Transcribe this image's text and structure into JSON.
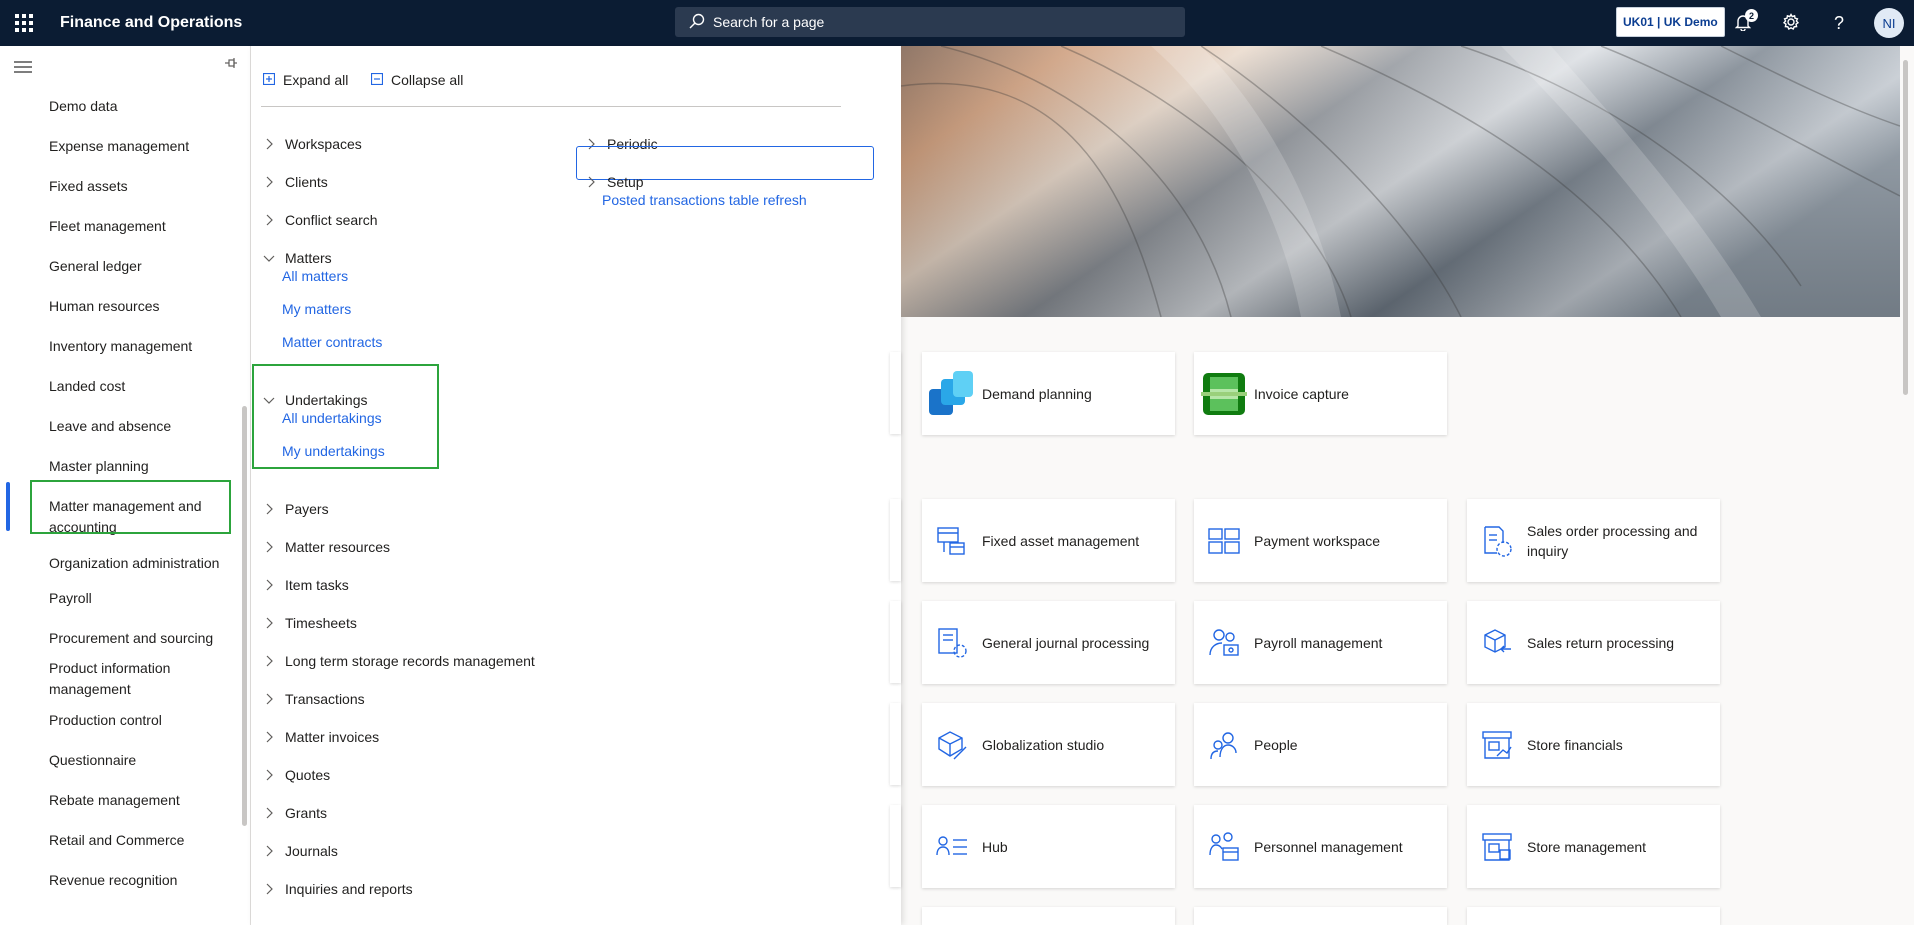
{
  "header": {
    "app_title": "Finance and Operations",
    "search_placeholder": "Search for a page",
    "company": "UK01 | UK Demo",
    "notification_count": "2",
    "help_label": "?",
    "avatar_initials": "NI"
  },
  "modules": [
    {
      "label": "Demo data"
    },
    {
      "label": "Expense management"
    },
    {
      "label": "Fixed assets"
    },
    {
      "label": "Fleet management"
    },
    {
      "label": "General ledger"
    },
    {
      "label": "Human resources"
    },
    {
      "label": "Inventory management"
    },
    {
      "label": "Landed cost"
    },
    {
      "label": "Leave and absence"
    },
    {
      "label": "Master planning"
    },
    {
      "label": "Matter management and accounting",
      "selected": true
    },
    {
      "label": "Organization administration"
    },
    {
      "label": "Payroll"
    },
    {
      "label": "Procurement and sourcing"
    },
    {
      "label": "Product information management"
    },
    {
      "label": "Production control"
    },
    {
      "label": "Questionnaire"
    },
    {
      "label": "Rebate management"
    },
    {
      "label": "Retail and Commerce"
    },
    {
      "label": "Revenue recognition"
    }
  ],
  "menu": {
    "expand_all": "Expand all",
    "collapse_all": "Collapse all",
    "col1": {
      "workspaces": "Workspaces",
      "clients": "Clients",
      "conflict_search": "Conflict search",
      "matters": "Matters",
      "all_matters": "All matters",
      "my_matters": "My matters",
      "matter_contracts": "Matter contracts",
      "undertakings": "Undertakings",
      "all_undertakings": "All undertakings",
      "my_undertakings": "My undertakings",
      "payers": "Payers",
      "matter_resources": "Matter resources",
      "item_tasks": "Item tasks",
      "timesheets": "Timesheets",
      "long_term_storage": "Long term storage records management",
      "transactions": "Transactions",
      "matter_invoices": "Matter invoices",
      "quotes": "Quotes",
      "grants": "Grants",
      "journals": "Journals",
      "inquiries_reports": "Inquiries and reports"
    },
    "col2": {
      "periodic": "Periodic",
      "setup": "Setup",
      "posted_refresh": "Posted transactions table refresh"
    }
  },
  "tiles": {
    "demand_planning": "Demand planning",
    "invoice_capture": "Invoice capture",
    "fixed_asset_management": "Fixed asset management",
    "payment_workspace": "Payment workspace",
    "sales_order_processing": "Sales order processing and inquiry",
    "general_journal_processing": "General journal processing",
    "payroll_management": "Payroll management",
    "sales_return_processing": "Sales return processing",
    "globalization_studio": "Globalization studio",
    "people": "People",
    "store_financials": "Store financials",
    "hub": "Hub",
    "personnel_management": "Personnel management",
    "store_management": "Store management"
  },
  "colors": {
    "topbar": "#0b1c33",
    "accent": "#2266e3",
    "highlight": "#2ca43c"
  }
}
